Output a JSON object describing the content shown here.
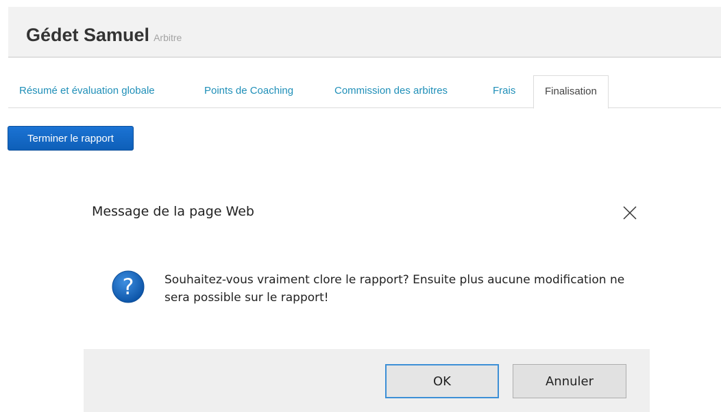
{
  "header": {
    "name": "Gédet Samuel",
    "role": "Arbitre"
  },
  "tabs": [
    {
      "label": "Résumé et évaluation globale",
      "active": false
    },
    {
      "label": "Points de Coaching",
      "active": false
    },
    {
      "label": "Commission des arbitres",
      "active": false
    },
    {
      "label": "Frais",
      "active": false
    },
    {
      "label": "Finalisation",
      "active": true
    }
  ],
  "actions": {
    "finish_label": "Terminer le rapport"
  },
  "dialog": {
    "title": "Message de la page Web",
    "message": "Souhaitez-vous vraiment clore le rapport? Ensuite plus aucune modification ne sera possible sur le rapport!",
    "ok_label": "OK",
    "cancel_label": "Annuler",
    "icon": "question-icon",
    "close_icon": "close-icon"
  },
  "colors": {
    "tab_link": "#1f8fb8",
    "primary_button": "#1b73d4",
    "question_icon": "#1565b8",
    "ok_focus_border": "#3c8fd6"
  }
}
